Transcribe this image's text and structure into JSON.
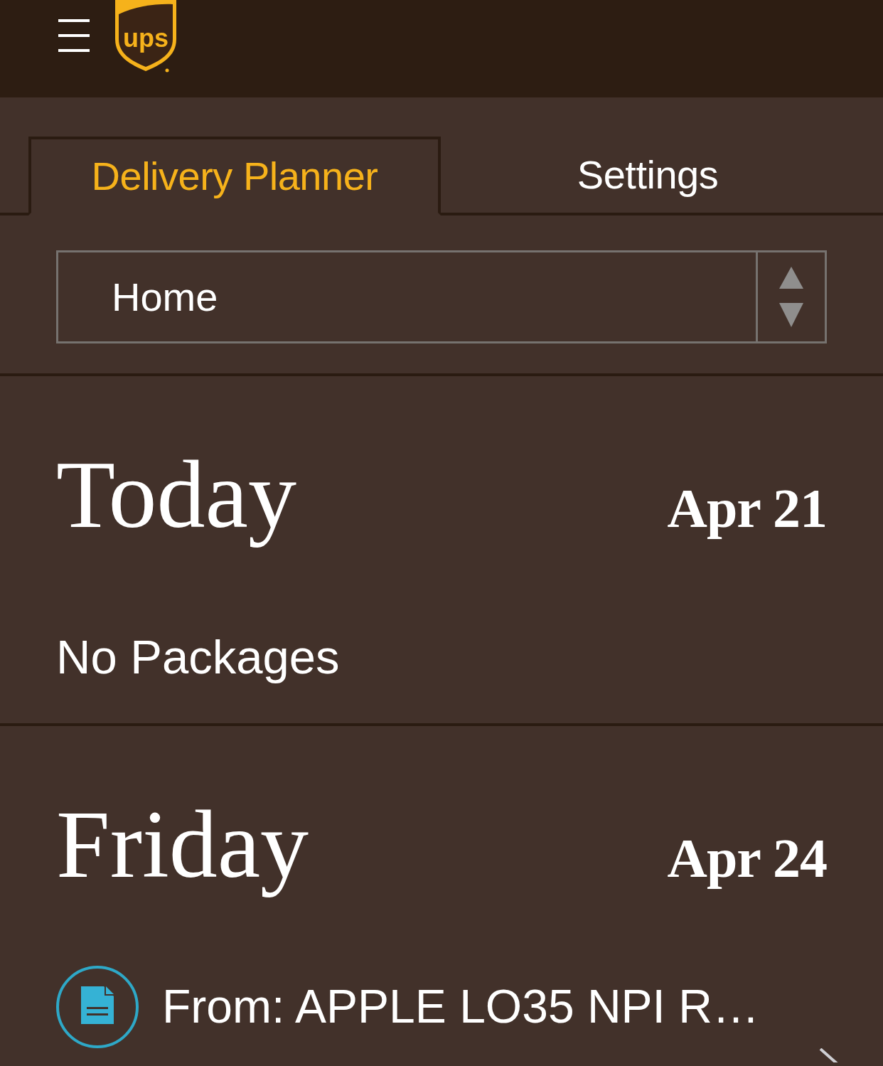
{
  "header": {
    "logo_text": "ups"
  },
  "tabs": [
    {
      "label": "Delivery Planner",
      "selected": true
    },
    {
      "label": "Settings",
      "selected": false
    }
  ],
  "location_select": {
    "value": "Home"
  },
  "days": [
    {
      "day": "Today",
      "date": "Apr 21",
      "message": "No Packages"
    },
    {
      "day": "Friday",
      "date": "Apr 24",
      "packages": [
        {
          "label": "From: APPLE LO35 NPI R…"
        }
      ]
    }
  ]
}
